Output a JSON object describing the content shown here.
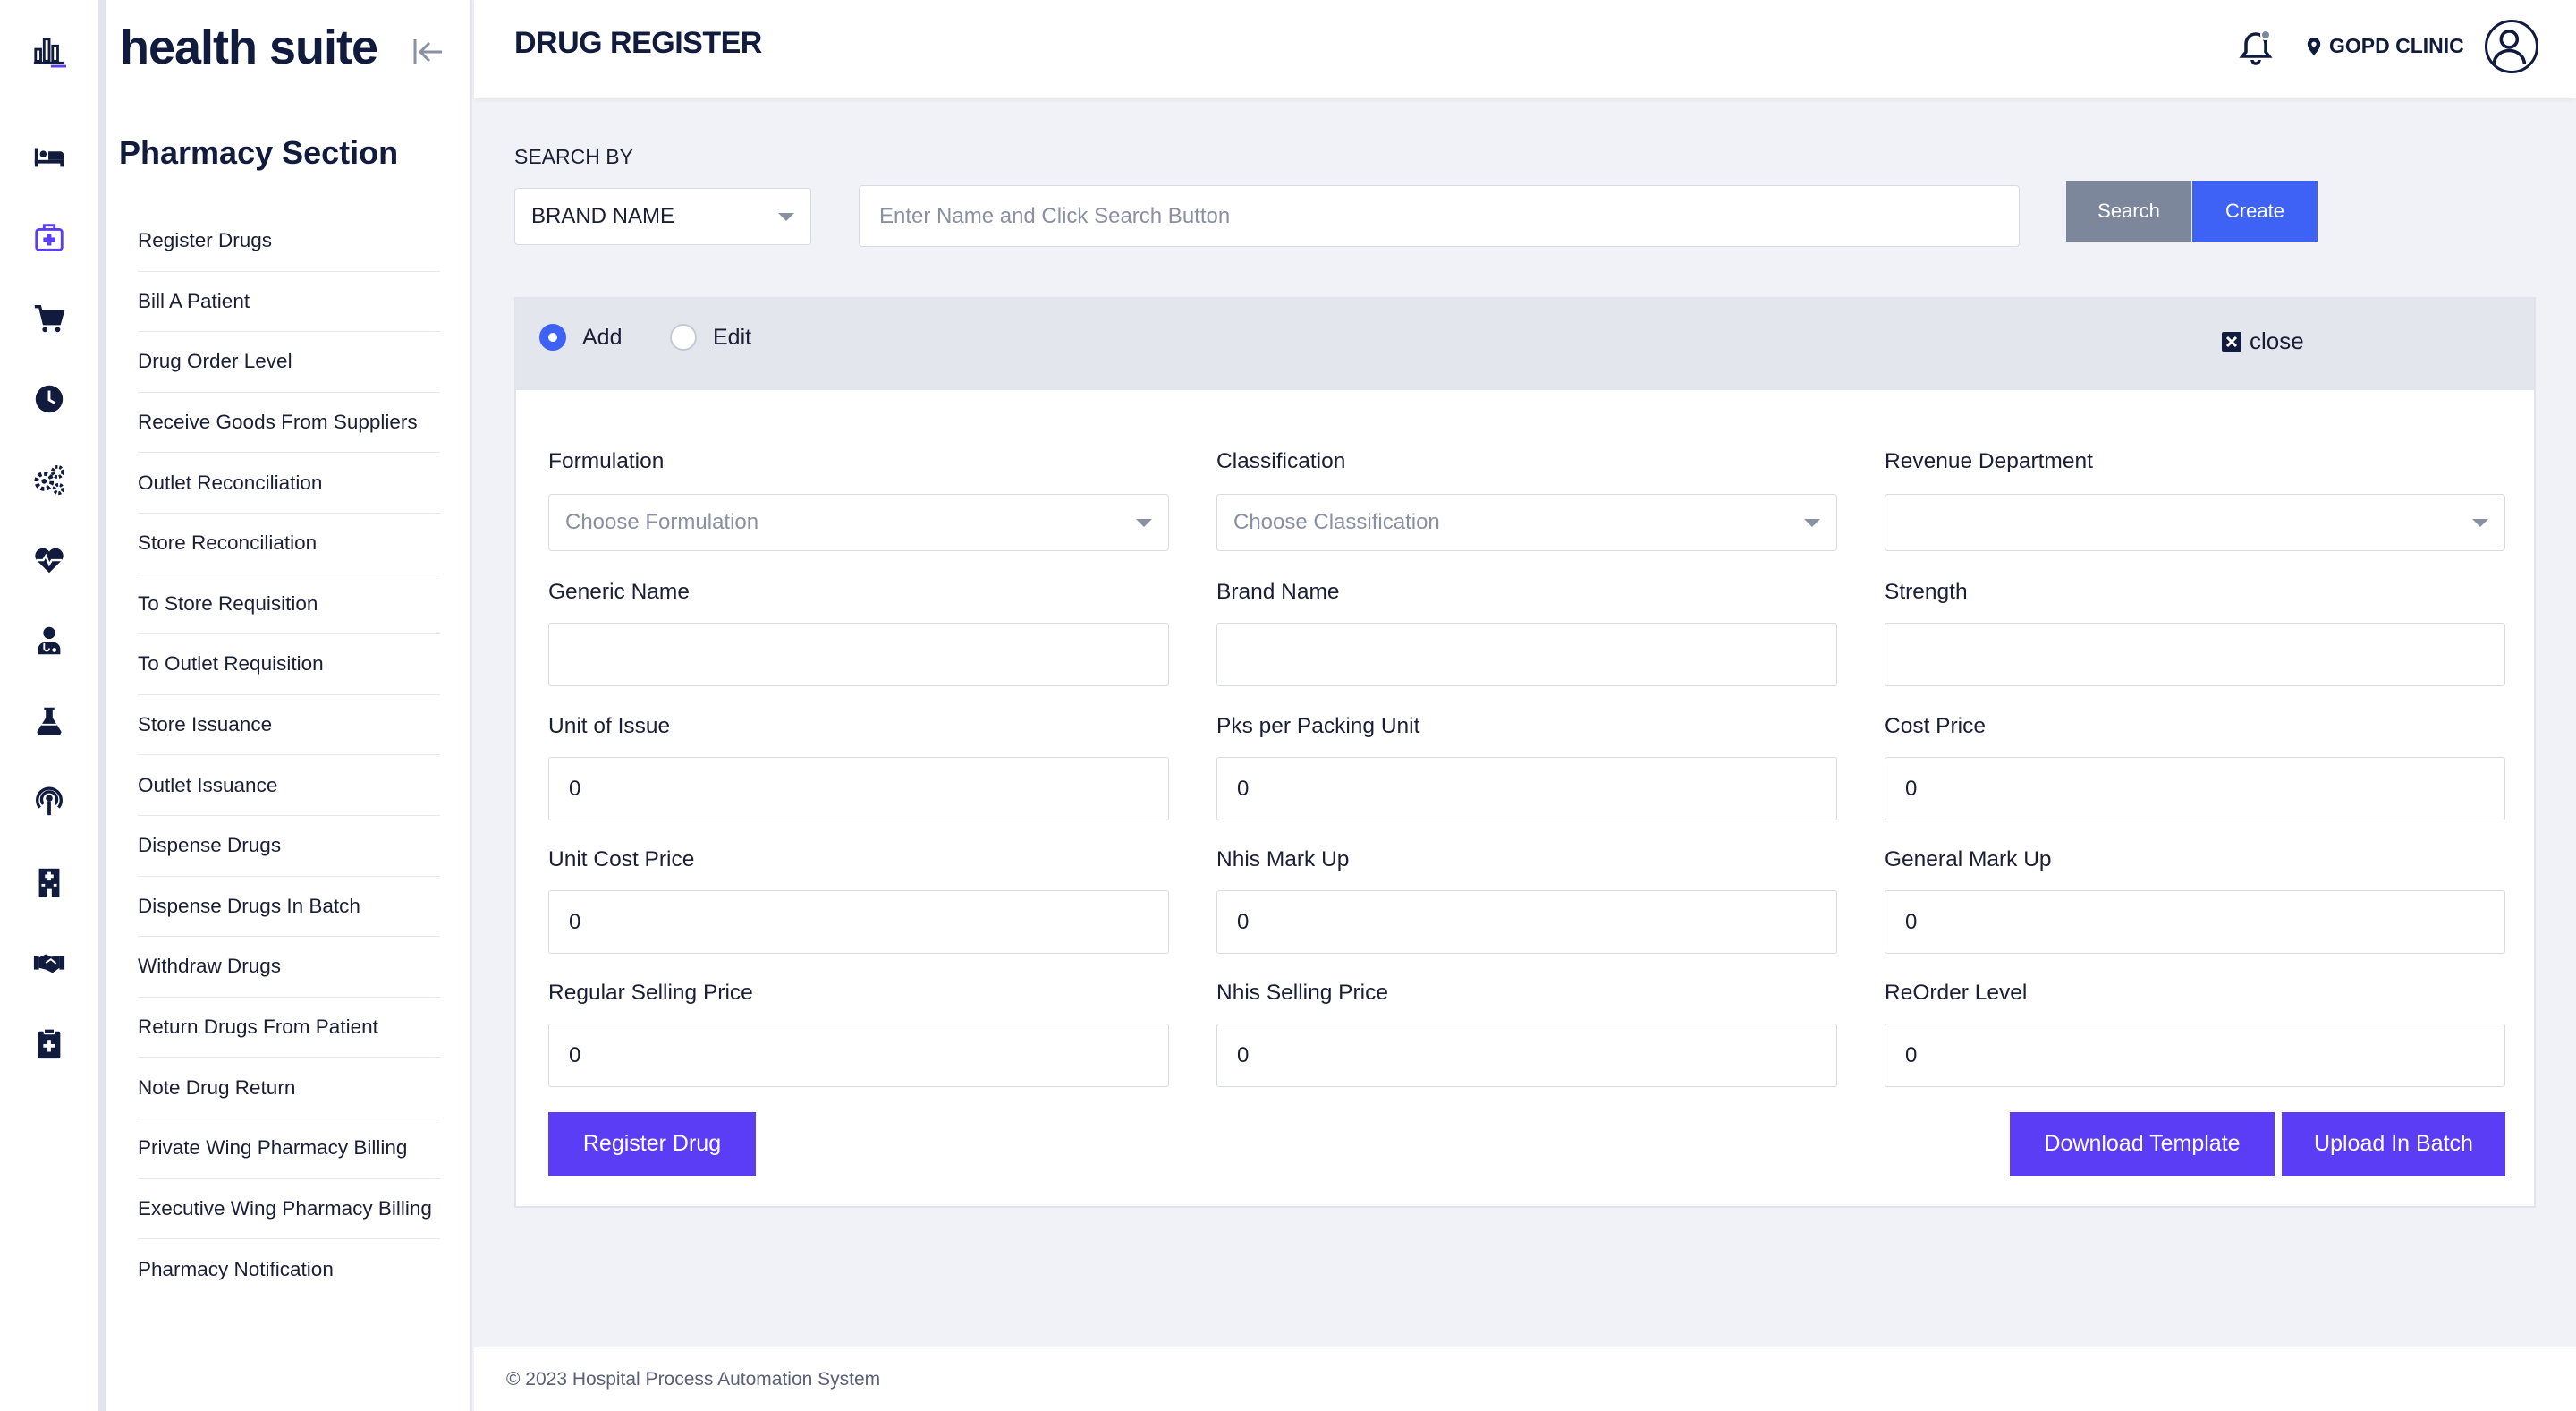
{
  "app": {
    "logo": "health suite"
  },
  "rail": {
    "icons": [
      "dashboard-icon",
      "bed-icon",
      "medical-kit-icon",
      "cart-icon",
      "clock-icon",
      "gears-icon",
      "heartbeat-icon",
      "doctor-icon",
      "flask-icon",
      "broadcast-icon",
      "hospital-icon",
      "handshake-icon",
      "clipboard-medical-icon"
    ],
    "active": "medical-kit-icon"
  },
  "sidebar": {
    "title": "Pharmacy Section",
    "items": [
      "Register Drugs",
      "Bill A Patient",
      "Drug Order Level",
      "Receive Goods From Suppliers",
      "Outlet Reconciliation",
      "Store Reconciliation",
      "To Store Requisition",
      "To Outlet Requisition",
      "Store Issuance",
      "Outlet Issuance",
      "Dispense Drugs",
      "Dispense Drugs In Batch",
      "Withdraw Drugs",
      "Return Drugs From Patient",
      "Note Drug Return",
      "Private Wing Pharmacy Billing",
      "Executive Wing Pharmacy Billing",
      "Pharmacy Notification"
    ]
  },
  "topbar": {
    "title": "DRUG REGISTER",
    "clinic": "GOPD CLINIC"
  },
  "search": {
    "label": "SEARCH BY",
    "by_value": "BRAND NAME",
    "placeholder": "Enter Name and Click Search Button",
    "search_label": "Search",
    "create_label": "Create"
  },
  "form": {
    "mode_add": "Add",
    "mode_edit": "Edit",
    "selected_mode": "Add",
    "close_label": "close",
    "formulation": {
      "label": "Formulation",
      "placeholder": "Choose Formulation"
    },
    "classification": {
      "label": "Classification",
      "placeholder": "Choose Classification"
    },
    "revenue": {
      "label": "Revenue Department",
      "value": ""
    },
    "generic_name": {
      "label": "Generic Name",
      "value": ""
    },
    "brand_name": {
      "label": "Brand Name",
      "value": ""
    },
    "strength": {
      "label": "Strength",
      "value": ""
    },
    "unit_issue": {
      "label": "Unit of Issue",
      "value": "0"
    },
    "pks_packing": {
      "label": "Pks per Packing Unit",
      "value": "0"
    },
    "cost_price": {
      "label": "Cost Price",
      "value": "0"
    },
    "unit_cost": {
      "label": "Unit Cost Price",
      "value": "0"
    },
    "nhis_markup": {
      "label": "Nhis Mark Up",
      "value": "0"
    },
    "general_markup": {
      "label": "General Mark Up",
      "value": "0"
    },
    "regular_selling": {
      "label": "Regular Selling Price",
      "value": "0"
    },
    "nhis_selling": {
      "label": "Nhis Selling Price",
      "value": "0"
    },
    "reorder_level": {
      "label": "ReOrder Level",
      "value": "0"
    },
    "register_label": "Register Drug",
    "download_label": "Download Template",
    "upload_label": "Upload In Batch"
  },
  "footer": {
    "text": "© 2023 Hospital Process Automation System"
  },
  "colors": {
    "primary": "#5b3df5",
    "blue": "#3d62f5",
    "gray_btn": "#7d879c",
    "navy": "#101b3d"
  }
}
